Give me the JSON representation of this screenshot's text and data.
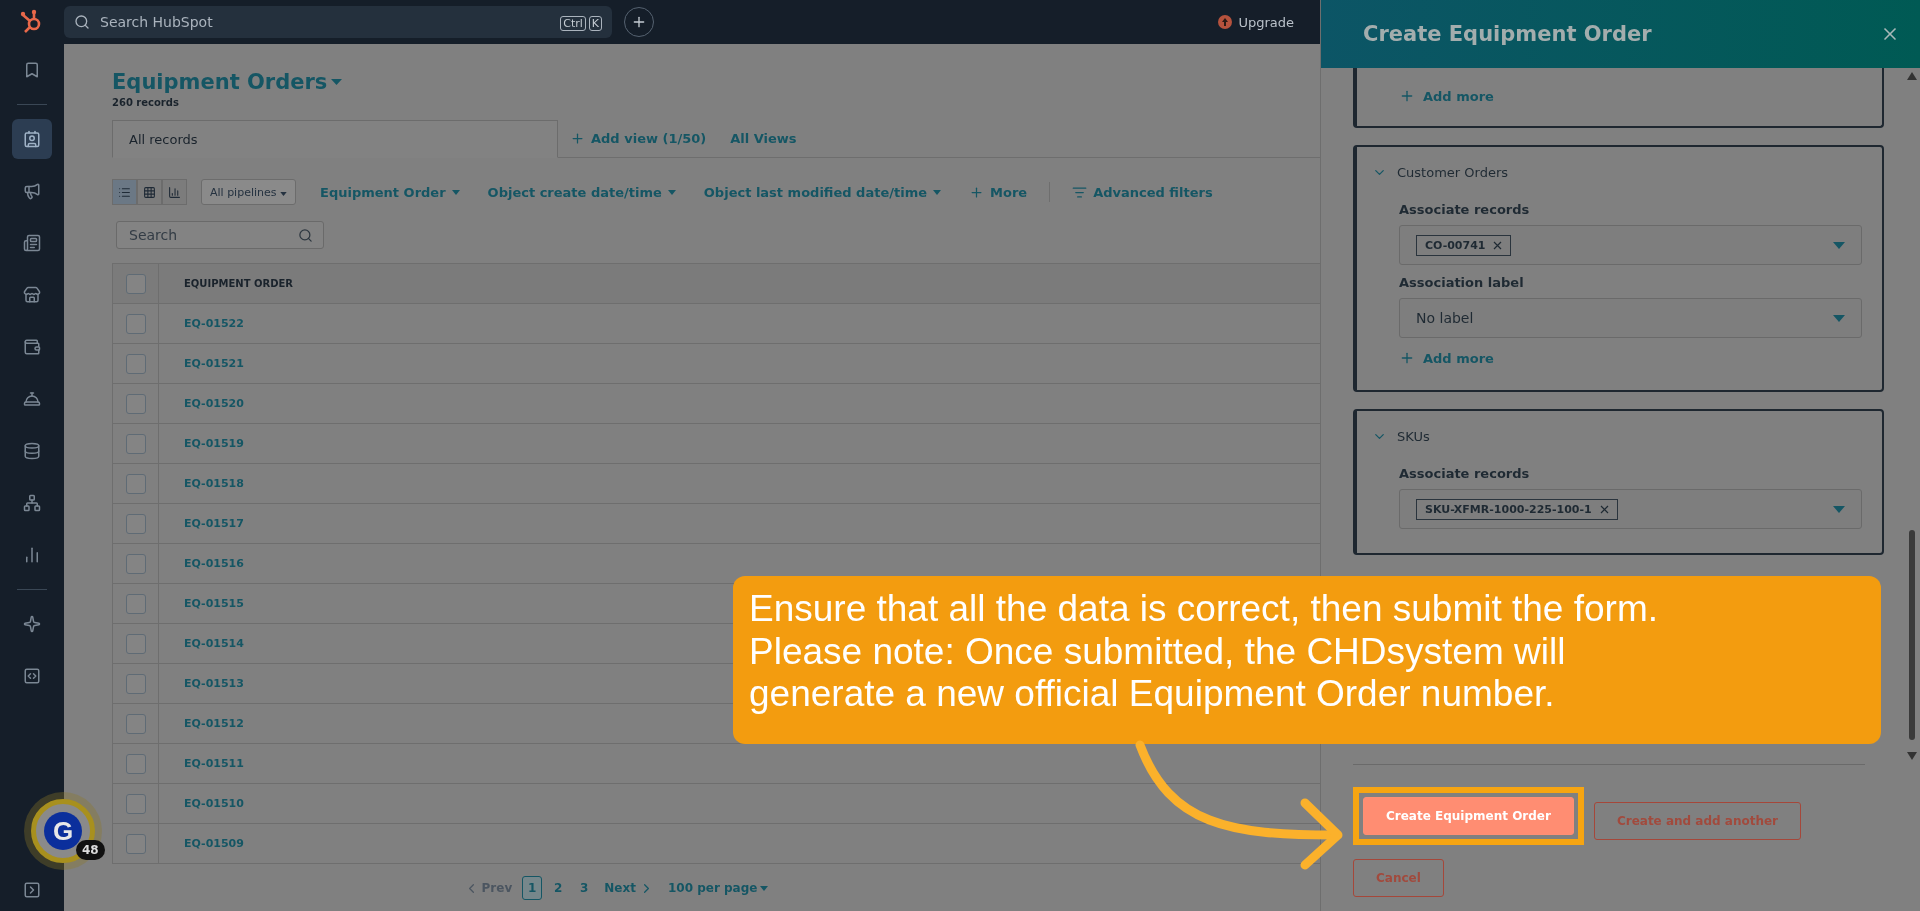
{
  "top_bar": {
    "search_placeholder": "Search HubSpot",
    "shortcut_keys": [
      "Ctrl",
      "K"
    ],
    "upgrade": "Upgrade"
  },
  "sidebar": {
    "groups": [
      [
        {
          "kind": "bookmark",
          "selected": false
        }
      ],
      [
        {
          "kind": "contacts",
          "selected": true
        },
        {
          "kind": "marketing",
          "selected": false
        },
        {
          "kind": "content",
          "selected": false
        },
        {
          "kind": "commerce",
          "selected": false
        },
        {
          "kind": "payments",
          "selected": false
        },
        {
          "kind": "service",
          "selected": false
        },
        {
          "kind": "data",
          "selected": false
        },
        {
          "kind": "automation",
          "selected": false
        },
        {
          "kind": "reporting",
          "selected": false
        }
      ],
      [
        {
          "kind": "assistant",
          "selected": false
        },
        {
          "kind": "development",
          "selected": false
        }
      ]
    ]
  },
  "assistant_badge": {
    "letter": "G",
    "count": "48"
  },
  "header": {
    "title": "Equipment Orders",
    "record_count": "260 records"
  },
  "view_tabs": [
    {
      "label": "All records",
      "selected": true
    }
  ],
  "add_view": "Add view (1/50)",
  "all_views": "All Views",
  "toolbar": {
    "view_modes": [
      {
        "kind": "list",
        "selected": true
      },
      {
        "kind": "board",
        "selected": false
      },
      {
        "kind": "report",
        "selected": false
      }
    ],
    "pipeline": "All pipelines",
    "filters": [
      "Equipment Order",
      "Object create date/time",
      "Object last modified date/time"
    ],
    "more": "More",
    "advanced_filters": "Advanced filters"
  },
  "table_search": {
    "placeholder": "Search"
  },
  "table": {
    "select_all_checked": false,
    "columns": [
      "EQUIPMENT ORDER"
    ],
    "rows": [
      {
        "id": "EQ-01522",
        "checked": false
      },
      {
        "id": "EQ-01521",
        "checked": false
      },
      {
        "id": "EQ-01520",
        "checked": false
      },
      {
        "id": "EQ-01519",
        "checked": false
      },
      {
        "id": "EQ-01518",
        "checked": false
      },
      {
        "id": "EQ-01517",
        "checked": false
      },
      {
        "id": "EQ-01516",
        "checked": false
      },
      {
        "id": "EQ-01515",
        "checked": false
      },
      {
        "id": "EQ-01514",
        "checked": false
      },
      {
        "id": "EQ-01513",
        "checked": false
      },
      {
        "id": "EQ-01512",
        "checked": false
      },
      {
        "id": "EQ-01511",
        "checked": false
      },
      {
        "id": "EQ-01510",
        "checked": false
      },
      {
        "id": "EQ-01509",
        "checked": false
      }
    ]
  },
  "pagination": {
    "prev": "Prev",
    "pages": [
      {
        "label": "1",
        "selected": true
      },
      {
        "label": "2",
        "selected": false
      },
      {
        "label": "3",
        "selected": false
      }
    ],
    "next": "Next",
    "per_page": "100 per page"
  },
  "panel": {
    "title": "Create Equipment Order",
    "sections": [
      {
        "kind": "partial",
        "add_more": "Add more"
      },
      {
        "kind": "group",
        "title": "Customer Orders",
        "expanded": true,
        "fields": [
          {
            "kind": "tags",
            "label": "Associate records",
            "tags": [
              "CO-00741"
            ]
          },
          {
            "kind": "select",
            "label": "Association label",
            "value": "No label"
          }
        ],
        "add_more": "Add more"
      },
      {
        "kind": "group",
        "title": "SKUs",
        "expanded": true,
        "fields": [
          {
            "kind": "tags",
            "label": "Associate records",
            "tags": [
              "SKU-XFMR-1000-225-100-1"
            ]
          }
        ]
      }
    ],
    "buttons": [
      {
        "kind": "primary",
        "label": "Create Equipment Order",
        "highlighted": true
      },
      {
        "kind": "secondary",
        "label": "Create and add another",
        "highlighted": false
      },
      {
        "kind": "secondary",
        "label": "Cancel",
        "highlighted": false
      }
    ]
  },
  "callout": {
    "lines": [
      "Ensure that all the data is correct, then submit the form.",
      "Please note: Once submitted, the CHDsystem will",
      "generate a new official Equipment Order number."
    ]
  }
}
